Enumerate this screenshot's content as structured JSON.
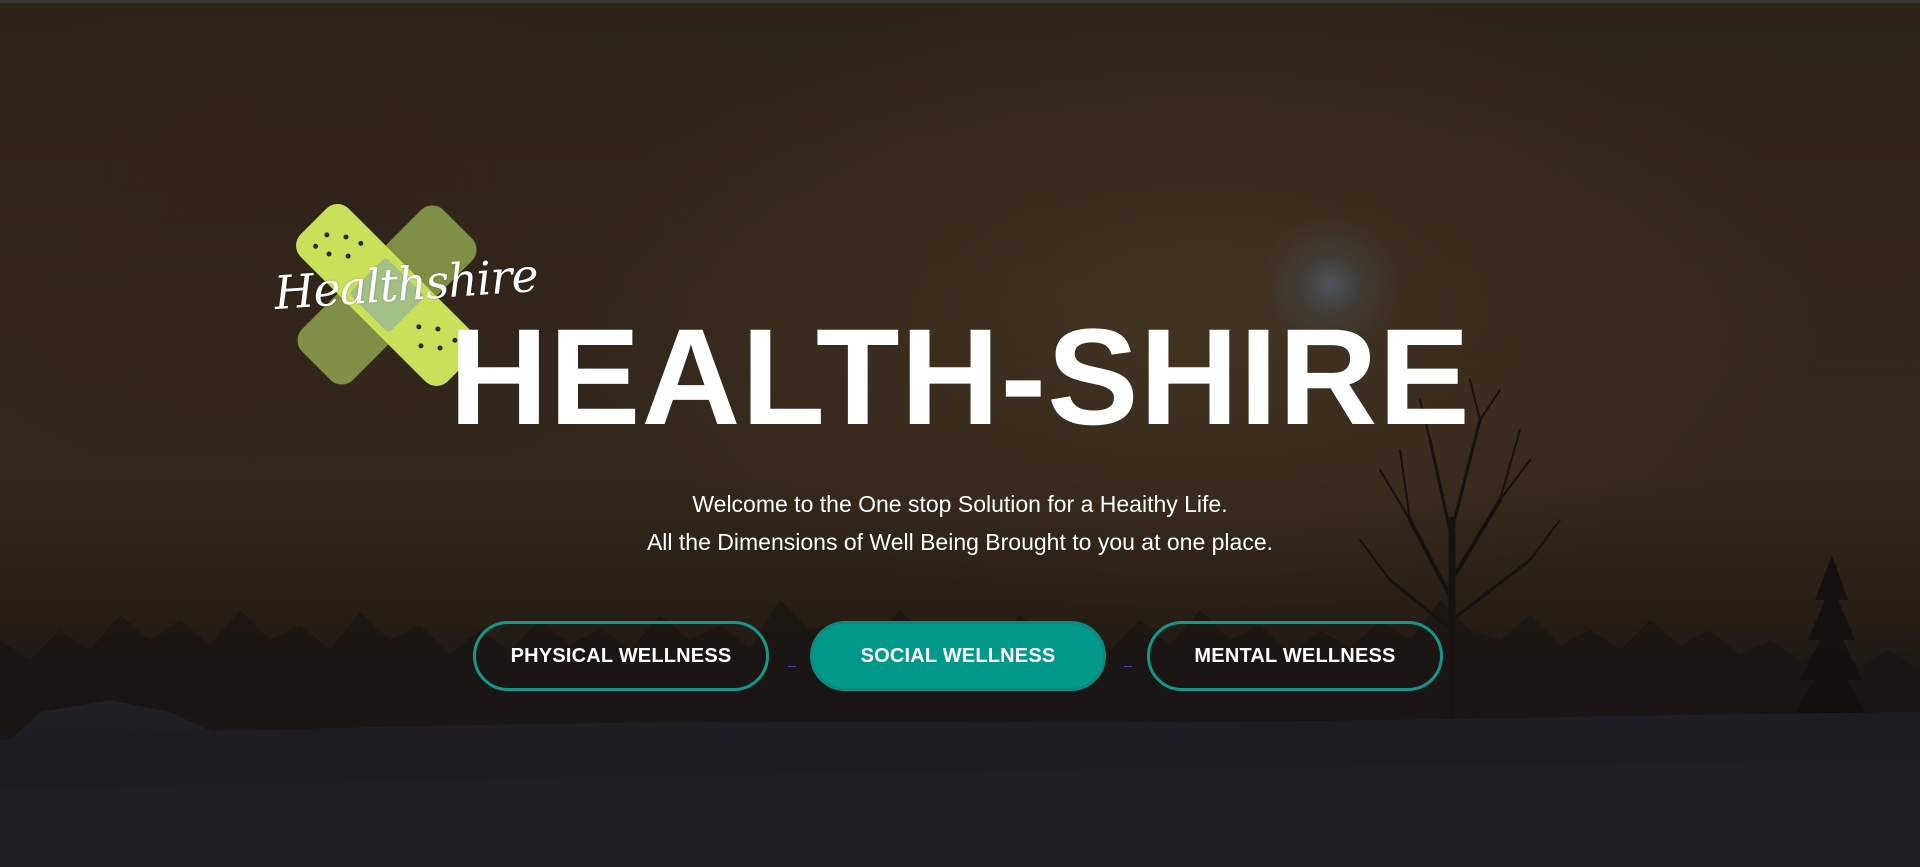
{
  "logo": {
    "text": "Healthshire"
  },
  "hero": {
    "title": "HEALTH-SHIRE",
    "subtitle_line1": "Welcome to the One stop Solution for a Heaithy Life.",
    "subtitle_line2": "All the Dimensions of Well Being Brought to you at one place."
  },
  "buttons": {
    "physical": "PHYSICAL WELLNESS",
    "social": "SOCIAL WELLNESS",
    "mental": "MENTAL WELLNESS"
  },
  "colors": {
    "accent": "#00998a",
    "logo_light_green": "#c9e05a",
    "logo_dark_green": "#7f8f45"
  }
}
